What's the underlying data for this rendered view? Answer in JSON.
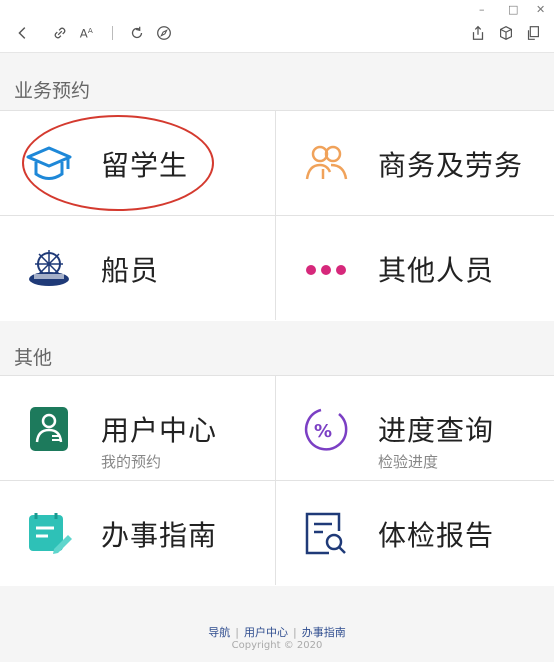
{
  "window": {
    "minimize": "–",
    "maximize": "□",
    "close": "✕"
  },
  "sections": {
    "business": "业务预约",
    "other": "其他"
  },
  "items": {
    "study_abroad": {
      "label": "留学生"
    },
    "business_labor": {
      "label": "商务及劳务"
    },
    "seafarer": {
      "label": "船员"
    },
    "others_people": {
      "label": "其他人员"
    },
    "user_center": {
      "label": "用户中心",
      "sub": "我的预约"
    },
    "progress": {
      "label": "进度查询",
      "sub": "检验进度"
    },
    "guide": {
      "label": "办事指南"
    },
    "report": {
      "label": "体检报告"
    }
  },
  "footer": {
    "links": [
      "导航",
      "用户中心",
      "办事指南"
    ],
    "copyright": "Copyright © 2020"
  },
  "colors": {
    "accent_blue": "#1e88d8",
    "accent_orange": "#f0a25a",
    "accent_pink": "#d6287b",
    "accent_green": "#1d7a5c",
    "accent_purple": "#7b3fc4",
    "accent_teal": "#2ec1b7",
    "accent_navy": "#1f3a78",
    "annotation_red": "#d43a2f"
  }
}
